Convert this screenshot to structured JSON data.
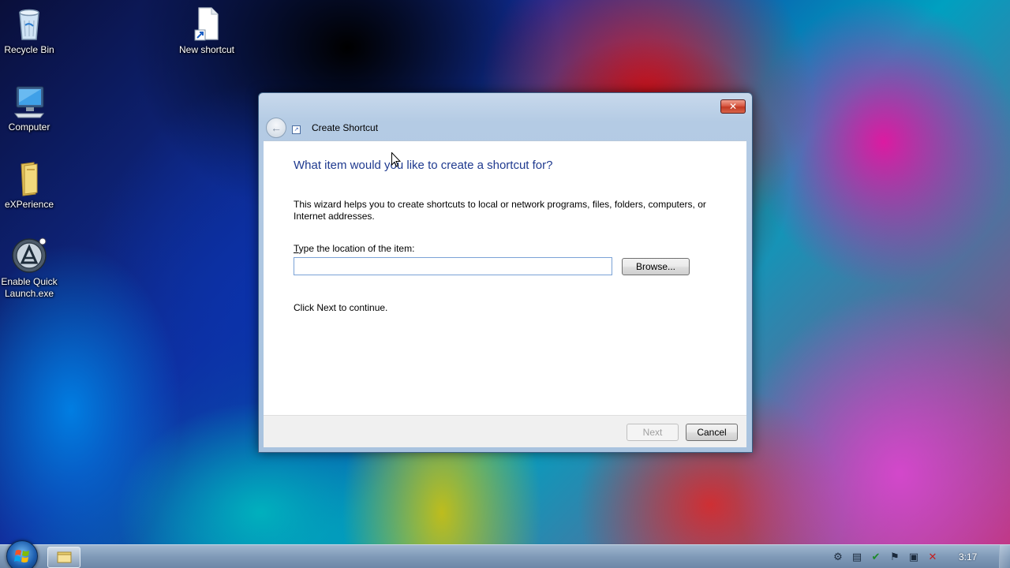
{
  "desktop": {
    "icons": [
      {
        "name": "recycle-bin",
        "label": "Recycle Bin",
        "icon": "recycle-bin-icon"
      },
      {
        "name": "new-shortcut",
        "label": "New shortcut",
        "icon": "shortcut-file-icon"
      },
      {
        "name": "computer",
        "label": "Computer",
        "icon": "computer-icon"
      },
      {
        "name": "experience",
        "label": "eXPerience",
        "icon": "folder-icon"
      },
      {
        "name": "enable-quick-launch",
        "label": "Enable Quick Launch.exe",
        "icon": "app-icon"
      }
    ]
  },
  "dialog": {
    "title": "Create Shortcut",
    "close_glyph": "✕",
    "back_glyph": "←",
    "heading": "What item would you like to create a shortcut for?",
    "description": "This wizard helps you to create shortcuts to local or network programs, files, folders, computers, or Internet addresses.",
    "location_label": "Type the location of the item:",
    "location_value": "",
    "browse_label": "Browse...",
    "continue_hint": "Click Next to continue.",
    "next_label": "Next",
    "cancel_label": "Cancel"
  },
  "taskbar": {
    "clock": "3:17",
    "tray_icons": [
      "network-icon",
      "document-icon",
      "security-check-icon",
      "action-center-flag-icon",
      "display-icon",
      "volume-muted-icon"
    ]
  },
  "colors": {
    "heading": "#1f3a8f",
    "close_button": "#c94a33"
  }
}
